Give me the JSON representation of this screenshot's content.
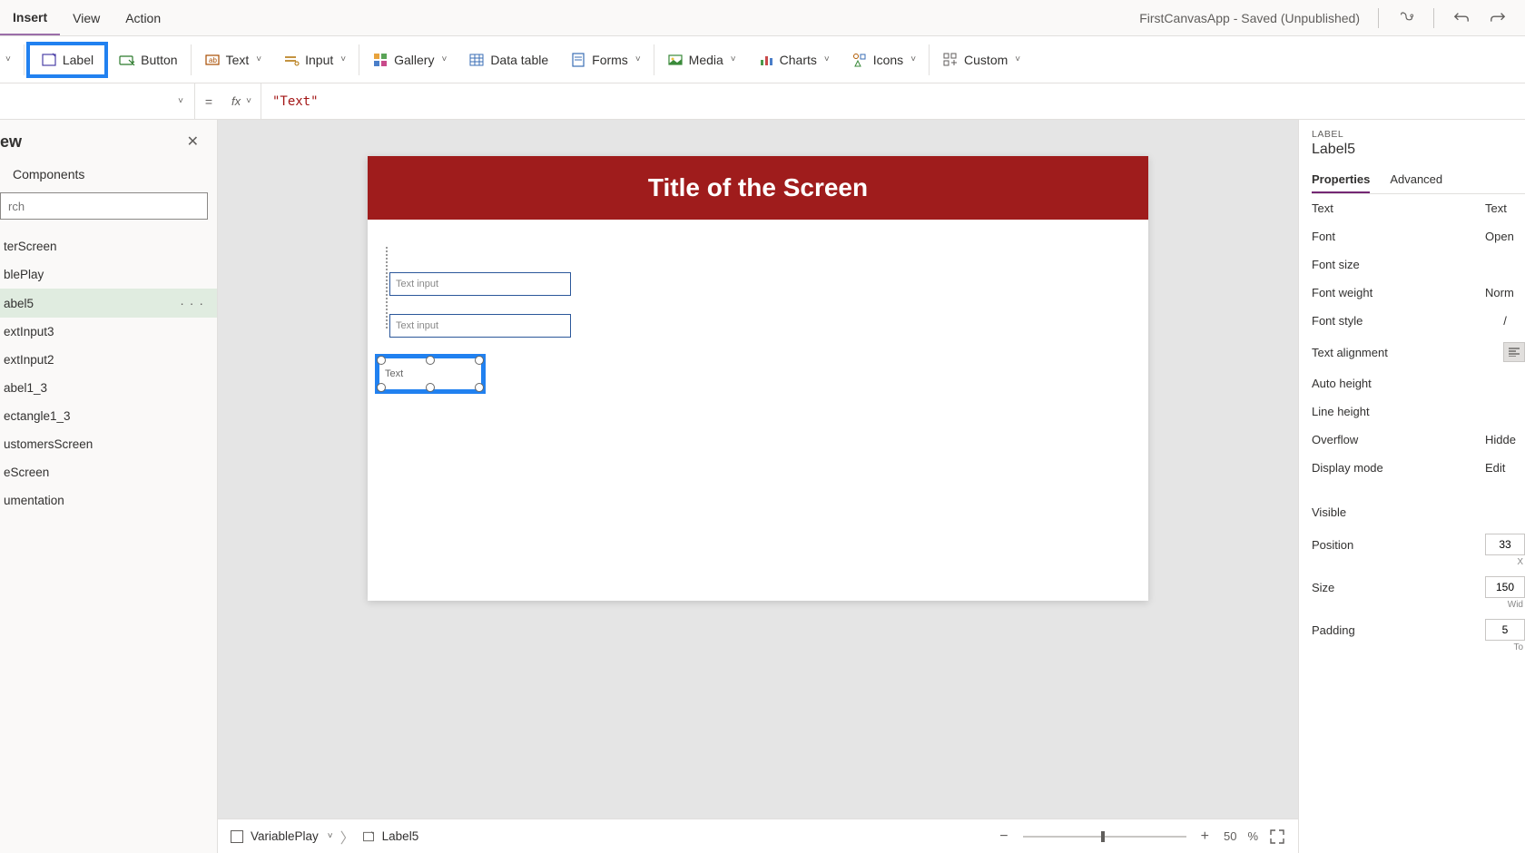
{
  "menubar": {
    "insert": "Insert",
    "view": "View",
    "action": "Action"
  },
  "title": "FirstCanvasApp - Saved (Unpublished)",
  "ribbon": {
    "first_trunc_chev": "˅",
    "label": "Label",
    "button": "Button",
    "text": "Text",
    "input": "Input",
    "gallery": "Gallery",
    "datatable": "Data table",
    "forms": "Forms",
    "media": "Media",
    "charts": "Charts",
    "icons": "Icons",
    "custom": "Custom"
  },
  "formula": {
    "fx": "fx",
    "value": "\"Text\""
  },
  "tree": {
    "title_suffix": "ew",
    "tab": "Components",
    "search_placeholder": "rch",
    "items": [
      "terScreen",
      "blePlay",
      "abel5",
      "extInput3",
      "extInput2",
      "abel1_3",
      "ectangle1_3",
      "ustomersScreen",
      "eScreen",
      "umentation"
    ],
    "selected": "abel5",
    "more": "· · ·"
  },
  "canvas": {
    "screen_title": "Title of the Screen",
    "text_input_placeholder": "Text input",
    "label_text": "Text"
  },
  "statusbar": {
    "crumb1": "VariablePlay",
    "crumb2": "Label5",
    "zoom": "50",
    "pct": "%"
  },
  "props": {
    "category": "LABEL",
    "name": "Label5",
    "tabs": {
      "properties": "Properties",
      "advanced": "Advanced"
    },
    "rows": {
      "text": {
        "label": "Text",
        "value": "Text"
      },
      "font": {
        "label": "Font",
        "value": "Open "
      },
      "fontsize": {
        "label": "Font size",
        "value": ""
      },
      "fontweight": {
        "label": "Font weight",
        "value": "Norm"
      },
      "fontstyle": {
        "label": "Font style",
        "value": "/"
      },
      "textalign": {
        "label": "Text alignment"
      },
      "autoheight": {
        "label": "Auto height"
      },
      "lineheight": {
        "label": "Line height"
      },
      "overflow": {
        "label": "Overflow",
        "value": "Hidde"
      },
      "displaymode": {
        "label": "Display mode",
        "value": "Edit"
      },
      "visible": {
        "label": "Visible"
      },
      "position": {
        "label": "Position",
        "value": "33",
        "sub": "X"
      },
      "size": {
        "label": "Size",
        "value": "150",
        "sub": "Wid"
      },
      "padding": {
        "label": "Padding",
        "value": "5",
        "sub": "To"
      }
    }
  }
}
